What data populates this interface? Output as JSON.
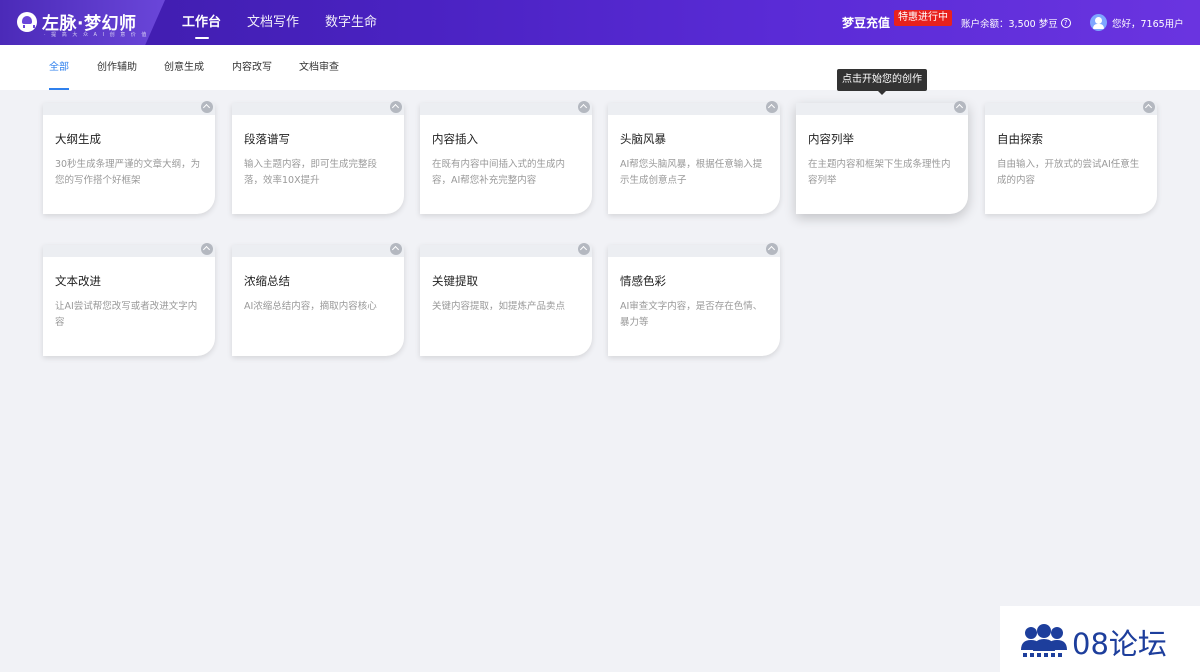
{
  "header": {
    "logo_text": "左脉·梦幻师",
    "logo_sub": "· 提 高 大 众 A I 创 意 价 值 ·",
    "nav": [
      "工作台",
      "文档写作",
      "数字生命"
    ],
    "recharge_label": "梦豆充值",
    "promo_badge": "特惠进行中",
    "balance_label": "账户余额：",
    "balance_value": "3,500 梦豆",
    "greeting": "您好，7165用户"
  },
  "subtabs": [
    "全部",
    "创作辅助",
    "创意生成",
    "内容改写",
    "文档审查"
  ],
  "tooltip": "点击开始您的创作",
  "cards": [
    {
      "title": "大纲生成",
      "desc": "30秒生成条理严谨的文章大纲，为您的写作搭个好框架"
    },
    {
      "title": "段落谱写",
      "desc": "输入主题内容，即可生成完整段落，效率10X提升"
    },
    {
      "title": "内容插入",
      "desc": "在既有内容中间插入式的生成内容，AI帮您补充完整内容"
    },
    {
      "title": "头脑风暴",
      "desc": "AI帮您头脑风暴，根据任意输入提示生成创意点子"
    },
    {
      "title": "内容列举",
      "desc": "在主题内容和框架下生成条理性内容列举"
    },
    {
      "title": "自由探索",
      "desc": "自由输入，开放式的尝试AI任意生成的内容"
    },
    {
      "title": "文本改进",
      "desc": "让AI尝试帮您改写或者改进文字内容"
    },
    {
      "title": "浓缩总结",
      "desc": "AI浓缩总结内容，摘取内容核心"
    },
    {
      "title": "关键提取",
      "desc": "关键内容提取，如提炼产品卖点"
    },
    {
      "title": "情感色彩",
      "desc": "AI审查文字内容，是否存在色情、暴力等"
    }
  ],
  "watermark": "08论坛",
  "colors": {
    "accent": "#2f80ed",
    "header": "#4a22c2",
    "badge": "#e8211d"
  }
}
